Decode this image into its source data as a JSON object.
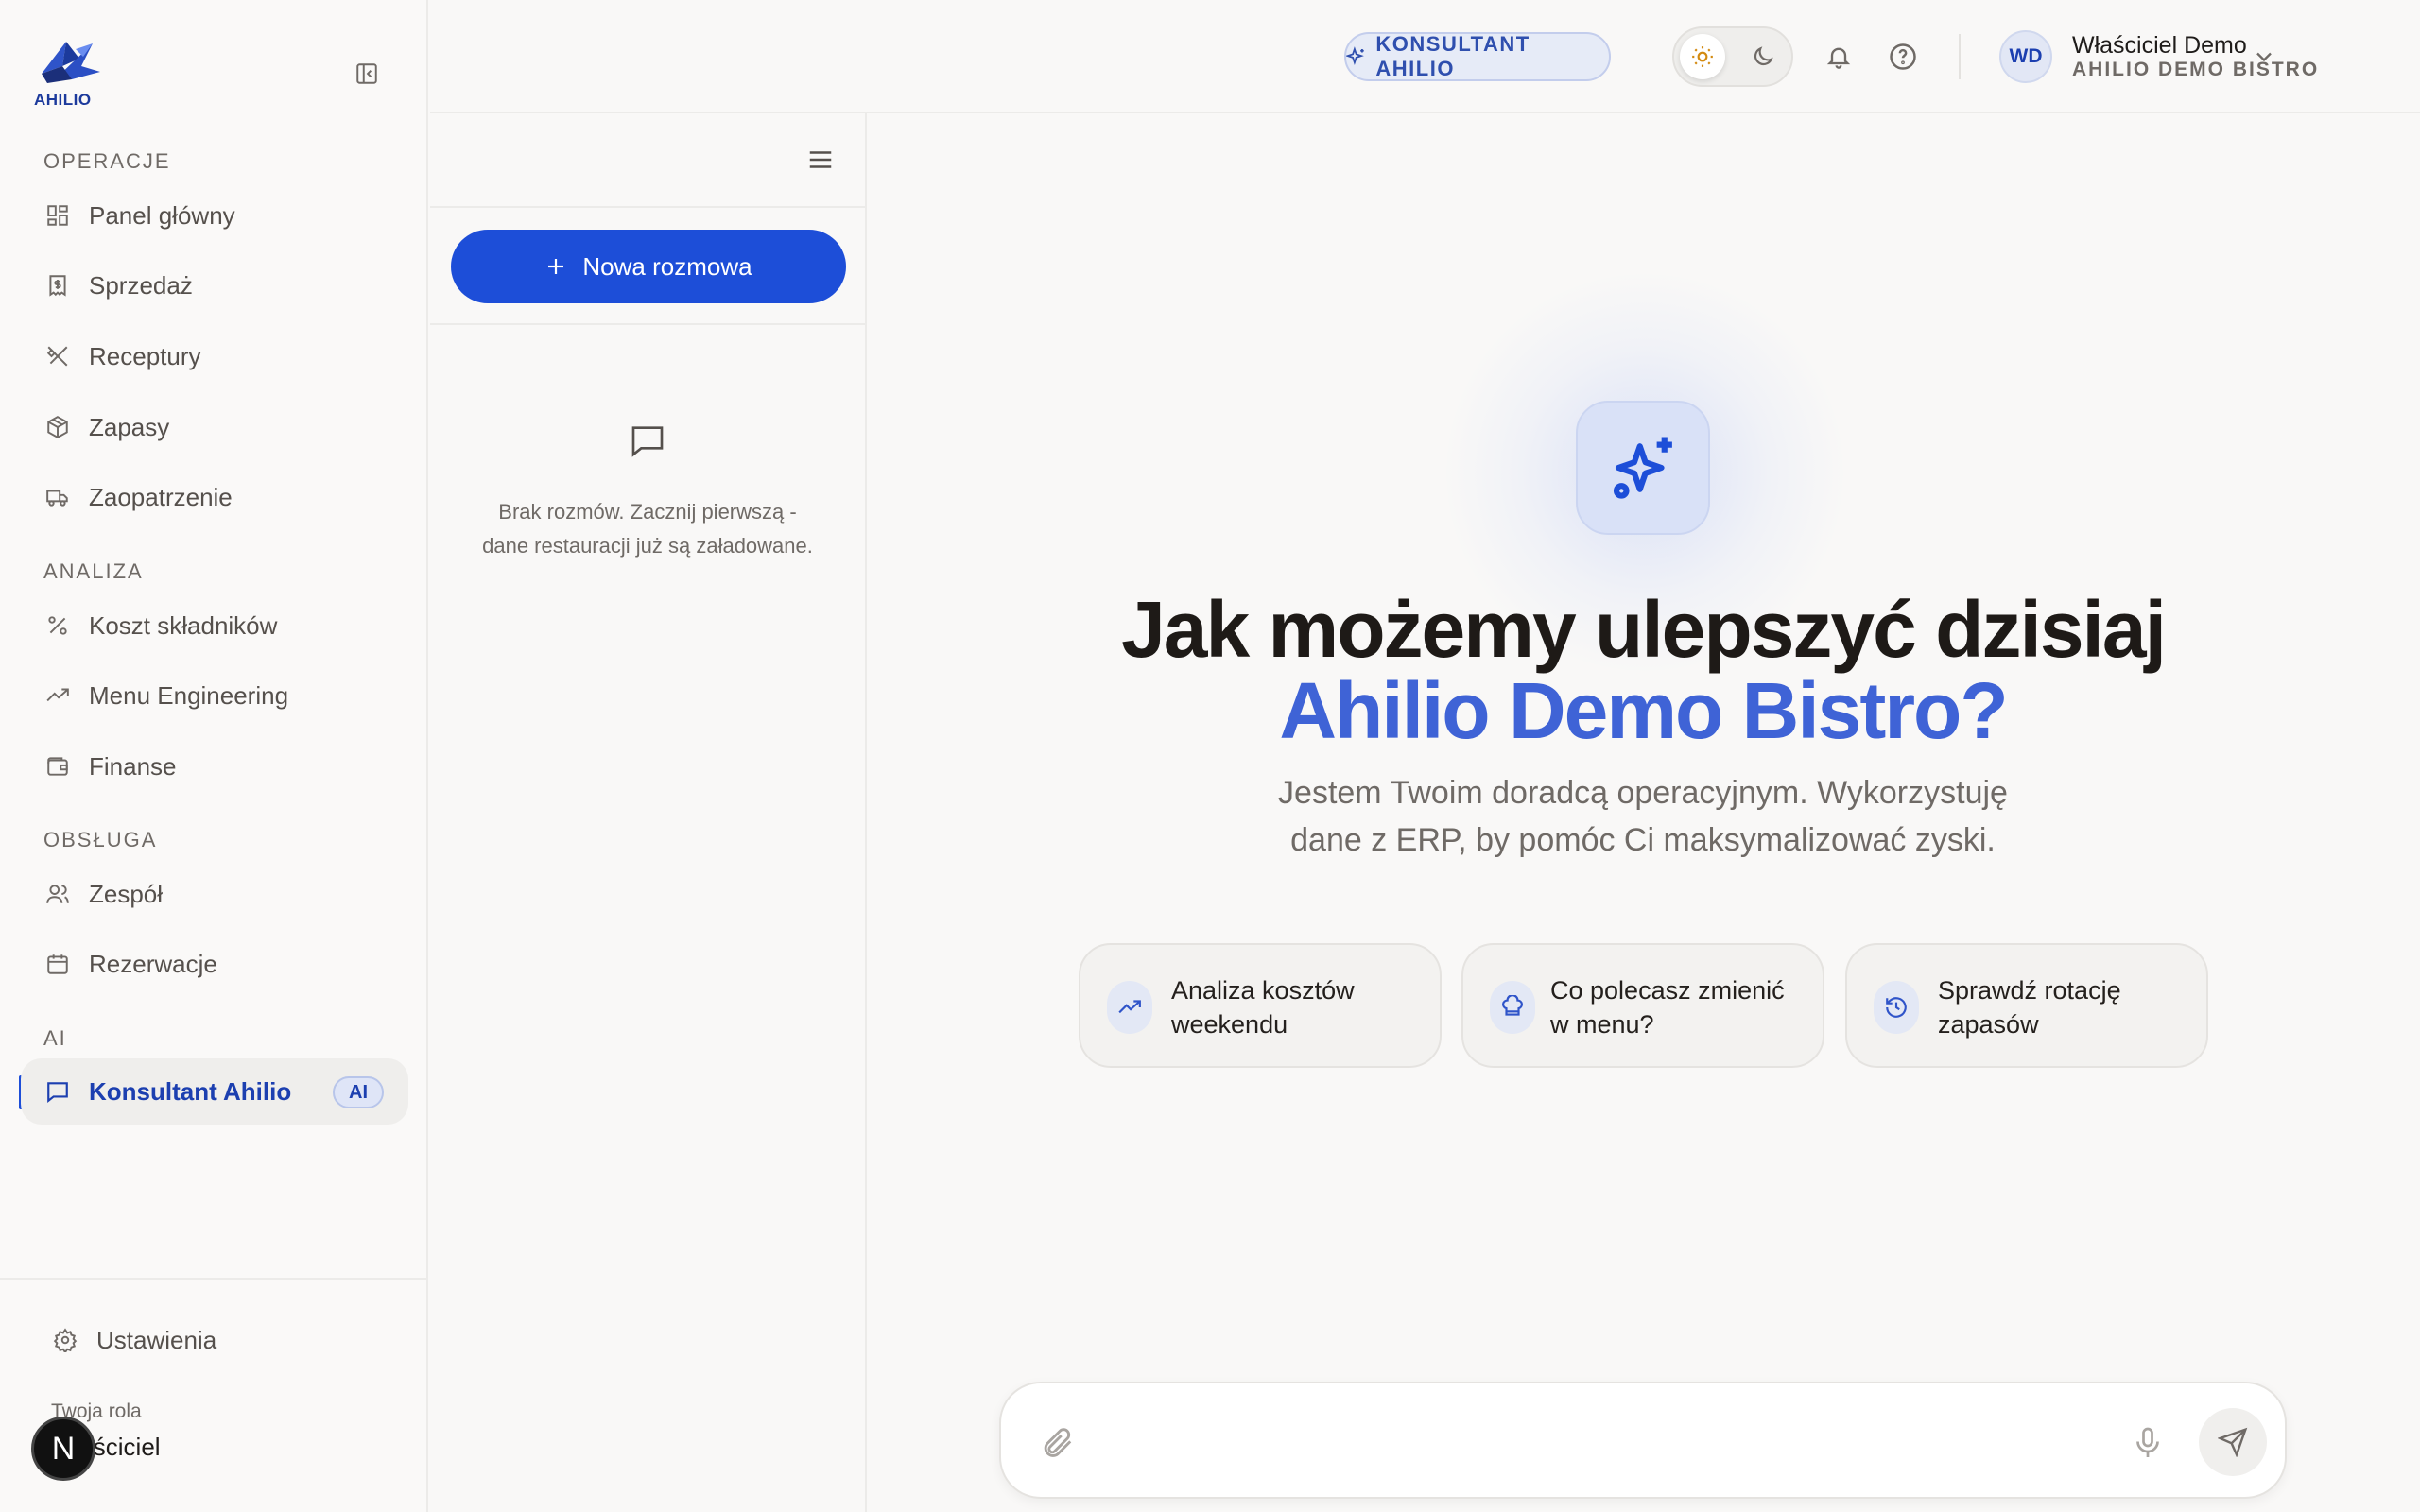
{
  "brand": {
    "logo_text": "AHILIO",
    "accent": "#1d4ed8",
    "highlight": "#3f63d6"
  },
  "sidebar": {
    "sections": [
      {
        "title": "OPERACJE"
      },
      {
        "title": "ANALIZA"
      },
      {
        "title": "OBSŁUGA"
      },
      {
        "title": "AI"
      }
    ],
    "items": [
      {
        "label": "Panel główny",
        "icon": "dashboard-icon"
      },
      {
        "label": "Sprzedaż",
        "icon": "receipt-icon"
      },
      {
        "label": "Receptury",
        "icon": "utensils-icon"
      },
      {
        "label": "Zapasy",
        "icon": "package-icon"
      },
      {
        "label": "Zaopatrzenie",
        "icon": "truck-icon"
      },
      {
        "label": "Koszt składników",
        "icon": "percent-icon"
      },
      {
        "label": "Menu Engineering",
        "icon": "trending-up-icon"
      },
      {
        "label": "Finanse",
        "icon": "wallet-icon"
      },
      {
        "label": "Zespół",
        "icon": "users-icon"
      },
      {
        "label": "Rezerwacje",
        "icon": "calendar-icon"
      },
      {
        "label": "Konsultant Ahilio",
        "icon": "chat-icon",
        "badge": "AI",
        "active": true
      }
    ],
    "settings_label": "Ustawienia",
    "role_label": "Twoja rola",
    "role_value": "Właściciel",
    "dev_badge": "N"
  },
  "chats": {
    "new_chat_label": "Nowa rozmowa",
    "empty_text_line1": "Brak rozmów. Zacznij pierwszą -",
    "empty_text_line2": "dane restauracji już są załadowane."
  },
  "header": {
    "consultant_label": "KONSULTANT AHILIO",
    "user": {
      "initials": "WD",
      "name": "Właściciel Demo",
      "org": "AHILIO DEMO BISTRO"
    }
  },
  "hero": {
    "title_line1": "Jak możemy ulepszyć dzisiaj",
    "title_line2": "Ahilio Demo Bistro?",
    "subtitle_line1": "Jestem Twoim doradcą operacyjnym. Wykorzystuję",
    "subtitle_line2": "dane z ERP, by pomóc Ci maksymalizować zyski."
  },
  "suggestions": [
    {
      "line1": "Analiza kosztów",
      "line2": "weekendu",
      "icon": "trending-up-icon"
    },
    {
      "line1": "Co polecasz zmienić",
      "line2": "w menu?",
      "icon": "chef-hat-icon"
    },
    {
      "line1": "Sprawdź rotację",
      "line2": "zapasów",
      "icon": "history-icon"
    }
  ],
  "composer": {
    "value": "",
    "placeholder": ""
  }
}
